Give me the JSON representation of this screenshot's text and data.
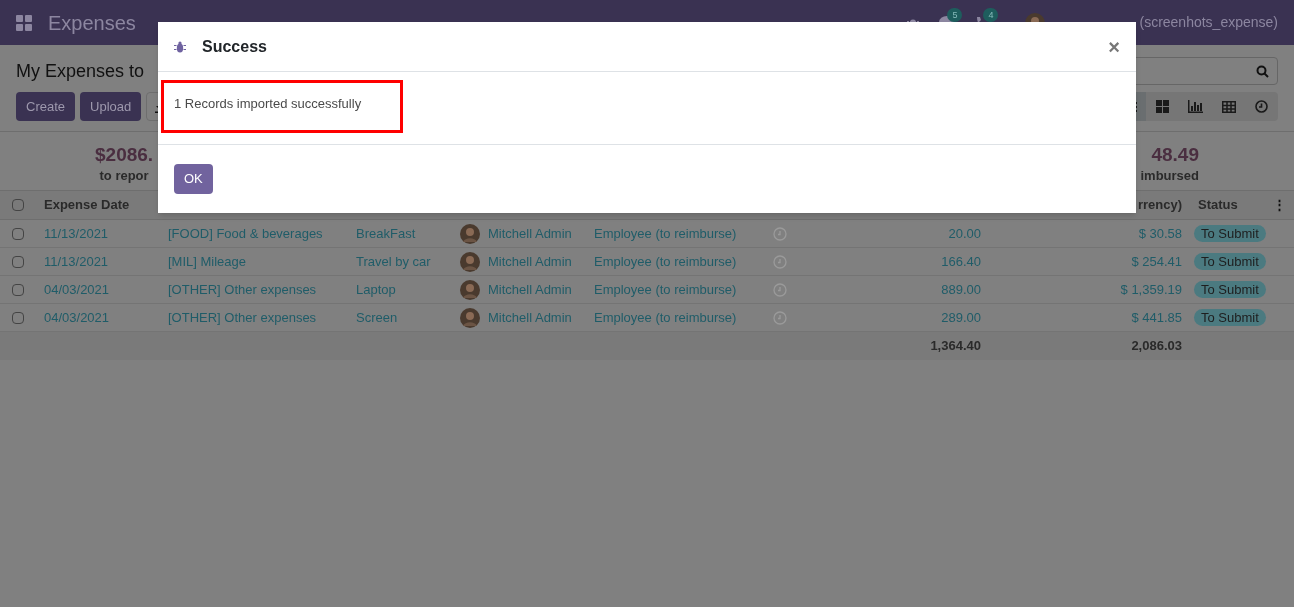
{
  "topbar": {
    "app": "Expenses",
    "chat_count": "5",
    "activity_count": "4",
    "user": "(screenhots_expense)"
  },
  "page": {
    "title": "My Expenses to",
    "buttons": [
      "Create",
      "Upload"
    ],
    "views": [
      {
        "kind": "list",
        "selected": true
      },
      {
        "kind": "kanban",
        "selected": false
      },
      {
        "kind": "graph",
        "selected": false
      },
      {
        "kind": "pivot",
        "selected": false
      },
      {
        "kind": "activity",
        "selected": false
      }
    ]
  },
  "summary": [
    {
      "amount": "$2086.",
      "label": "to repor"
    },
    {
      "amount": "48.49",
      "label": "imbursed"
    }
  ],
  "table": {
    "all_checked": false,
    "options": "⋮",
    "columns": [
      "Expense Date",
      "",
      "",
      "",
      "",
      "",
      "",
      "rrency)",
      "Status"
    ],
    "rows": [
      {
        "date": "11/13/2021",
        "category": "[FOOD] Food & beverages",
        "description": "BreakFast",
        "employee": "Mitchell Admin",
        "paid_by": "Employee (to reimburse)",
        "total": "20.00",
        "company_total": "$ 30.58",
        "status": "To Submit",
        "checked": false
      },
      {
        "date": "11/13/2021",
        "category": "[MIL] Mileage",
        "description": "Travel by car",
        "employee": "Mitchell Admin",
        "paid_by": "Employee (to reimburse)",
        "total": "166.40",
        "company_total": "$ 254.41",
        "status": "To Submit",
        "checked": false
      },
      {
        "date": "04/03/2021",
        "category": "[OTHER] Other expenses",
        "description": "Laptop",
        "employee": "Mitchell Admin",
        "paid_by": "Employee (to reimburse)",
        "total": "889.00",
        "company_total": "$ 1,359.19",
        "status": "To Submit",
        "checked": false
      },
      {
        "date": "04/03/2021",
        "category": "[OTHER] Other expenses",
        "description": "Screen",
        "employee": "Mitchell Admin",
        "paid_by": "Employee (to reimburse)",
        "total": "289.00",
        "company_total": "$ 441.85",
        "status": "To Submit",
        "checked": false
      }
    ],
    "totals": {
      "total": "1,364.40",
      "company_total": "2,086.03"
    }
  },
  "dialog": {
    "title": "Success",
    "message": "1 Records imported successfully",
    "button": "OK",
    "close": "×"
  }
}
